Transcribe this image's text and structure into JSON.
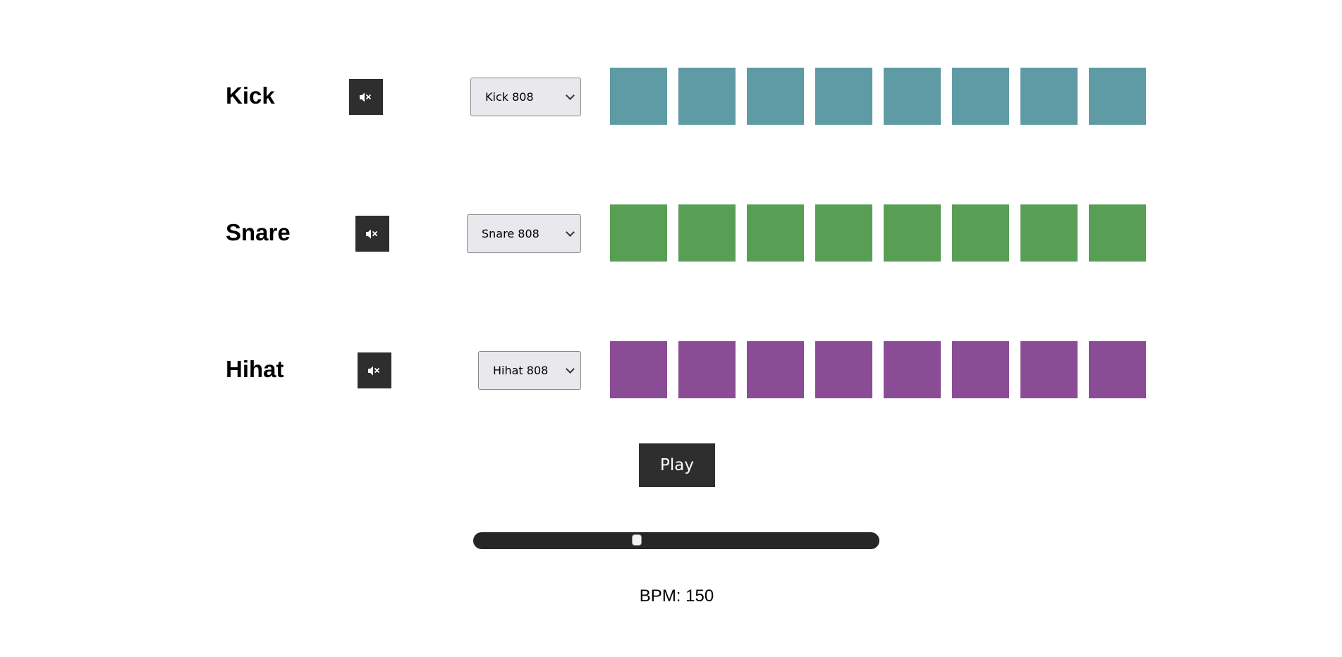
{
  "tracks": [
    {
      "name": "Kick",
      "sound": "Kick 808",
      "mute_icon": "speaker-mute-icon",
      "color": "#5e9ba4",
      "steps": [
        false,
        false,
        false,
        false,
        false,
        false,
        false,
        false
      ]
    },
    {
      "name": "Snare",
      "sound": "Snare 808",
      "mute_icon": "speaker-mute-icon",
      "color": "#599e55",
      "steps": [
        false,
        false,
        false,
        false,
        false,
        false,
        false,
        false
      ]
    },
    {
      "name": "Hihat",
      "sound": "Hihat 808",
      "mute_icon": "speaker-mute-icon",
      "color": "#8a4c94",
      "steps": [
        false,
        false,
        false,
        false,
        false,
        false,
        false,
        false
      ]
    }
  ],
  "controls": {
    "play_label": "Play",
    "bpm_label_prefix": "BPM:",
    "bpm_value": "150",
    "bpm_slider_fraction": 0.4
  }
}
